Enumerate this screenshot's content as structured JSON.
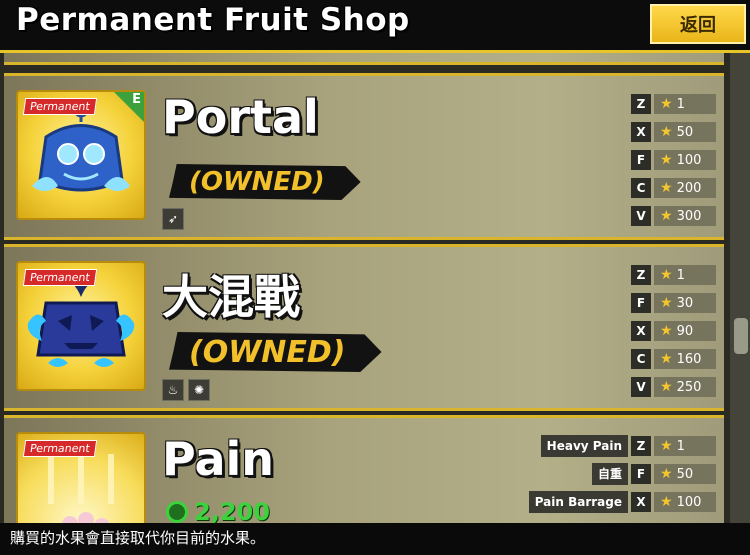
{
  "header": {
    "title": "Permanent Fruit Shop",
    "back_label": "返回"
  },
  "badge_label": "Permanent",
  "fruits": [
    {
      "name": "Portal",
      "status": "(OWNED)",
      "corner_letter": "E",
      "tags": [
        "dash-icon"
      ],
      "moves": [
        {
          "name": "",
          "key": "Z",
          "level": "1"
        },
        {
          "name": "",
          "key": "X",
          "level": "50"
        },
        {
          "name": "",
          "key": "F",
          "level": "100"
        },
        {
          "name": "",
          "key": "C",
          "level": "200"
        },
        {
          "name": "",
          "key": "V",
          "level": "300"
        }
      ]
    },
    {
      "name": "大混戰",
      "status": "(OWNED)",
      "tags": [
        "fire-icon",
        "burst-icon"
      ],
      "moves": [
        {
          "name": "",
          "key": "Z",
          "level": "1"
        },
        {
          "name": "",
          "key": "F",
          "level": "30"
        },
        {
          "name": "",
          "key": "X",
          "level": "90"
        },
        {
          "name": "",
          "key": "C",
          "level": "160"
        },
        {
          "name": "",
          "key": "V",
          "level": "250"
        }
      ]
    },
    {
      "name": "Pain",
      "price": "2,200",
      "moves": [
        {
          "name": "Heavy Pain",
          "key": "Z",
          "level": "1"
        },
        {
          "name": "自重",
          "key": "F",
          "level": "50"
        },
        {
          "name": "Pain Barrage",
          "key": "X",
          "level": "100"
        }
      ]
    }
  ],
  "footer": {
    "text": "購買的水果會直接取代你目前的水果。"
  },
  "colors": {
    "accent": "#e6c52a",
    "owned": "#f1c02a",
    "price": "#3dd23d",
    "badge": "#d62a2a"
  }
}
